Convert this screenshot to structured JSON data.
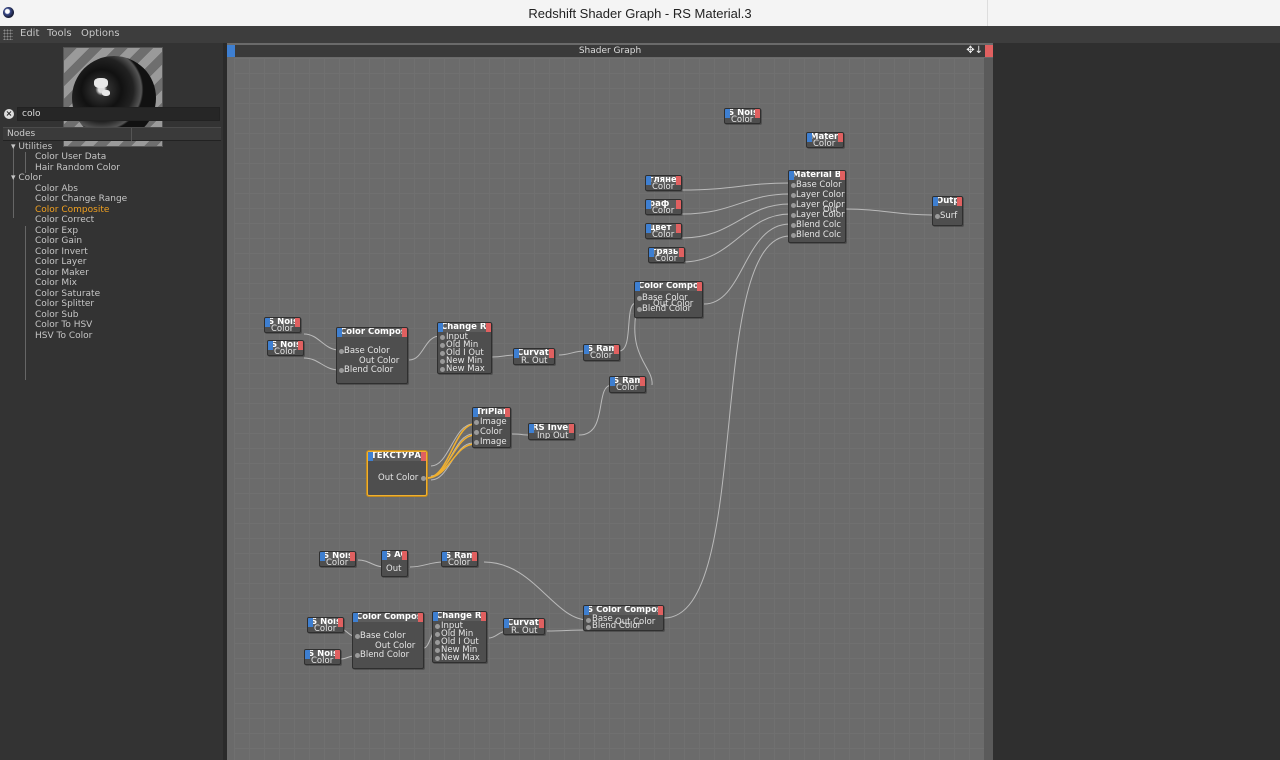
{
  "window": {
    "title": "Redshift Shader Graph - RS Material.3"
  },
  "menu": [
    "Edit",
    "Tools",
    "Options"
  ],
  "search": {
    "value": "colo"
  },
  "nodes_panel": {
    "header": "Nodes"
  },
  "tree": {
    "groups": [
      {
        "label": "Utilities",
        "items": [
          "Color User Data",
          "Hair Random Color"
        ]
      },
      {
        "label": "Color",
        "items": [
          "Color Abs",
          "Color Change Range",
          "Color Composite",
          "Color Correct",
          "Color Exp",
          "Color Gain",
          "Color Invert",
          "Color Layer",
          "Color Maker",
          "Color Mix",
          "Color Saturate",
          "Color Splitter",
          "Color Sub",
          "Color To HSV",
          "HSV To Color"
        ]
      }
    ],
    "highlighted": "Color Composite"
  },
  "graph": {
    "title": "Shader Graph",
    "toolbar_icons": [
      "move-icon",
      "arrow-down-icon"
    ],
    "nodes": [
      {
        "id": "noise_top",
        "title": "S Nois",
        "ports": [
          "Color"
        ]
      },
      {
        "id": "mater",
        "title": "Mater",
        "ports": [
          "Color"
        ]
      },
      {
        "id": "glyanec",
        "title": "глянец",
        "ports": [
          "Color"
        ]
      },
      {
        "id": "raf",
        "title": "раф",
        "ports": [
          "Color"
        ]
      },
      {
        "id": "cvet",
        "title": "цвет",
        "ports": [
          "Color"
        ]
      },
      {
        "id": "gryaz",
        "title": "грязь",
        "ports": [
          "Color"
        ]
      },
      {
        "id": "matblend",
        "title": "Material Blen",
        "ports": [
          "Base Color",
          "Layer Color",
          "Layer Color",
          "Layer Color",
          "Blend Colc",
          "Blend Colc"
        ],
        "out": "Out"
      },
      {
        "id": "output",
        "title": "Outpu",
        "ports": [
          "Surf"
        ]
      },
      {
        "id": "comp_top",
        "title": "Color Compo",
        "ports": [
          "Base Color",
          "Blend Color"
        ],
        "out": "Out Color"
      },
      {
        "id": "noise_a",
        "title": "S Nois",
        "ports": [
          "Color"
        ]
      },
      {
        "id": "noise_b",
        "title": "S Nois",
        "ports": [
          "Color"
        ]
      },
      {
        "id": "comp_mid",
        "title": "Color Compos",
        "ports": [
          "Base Color",
          "Blend Color"
        ],
        "out": "Out Color"
      },
      {
        "id": "range_mid",
        "title": "Change Ra",
        "ports": [
          "Input",
          "Old Min",
          "Old Max",
          "New Min",
          "New Max"
        ],
        "out": "Old I Out"
      },
      {
        "id": "curv_mid",
        "title": "Curvat",
        "ports": [
          "R. Out"
        ]
      },
      {
        "id": "ramp_mid",
        "title": "S Ram",
        "ports": [
          "Color"
        ]
      },
      {
        "id": "ramp_mid2",
        "title": "S Ram",
        "ports": [
          "Color"
        ]
      },
      {
        "id": "triplanar",
        "title": "TriPlar",
        "ports": [
          "Image",
          "Color",
          "Image"
        ]
      },
      {
        "id": "invert",
        "title": "RS Invert",
        "ports": [
          "Inp Out"
        ]
      },
      {
        "id": "texture",
        "title": "ТЕКСТУРА",
        "ports": [],
        "out": "Out Color"
      },
      {
        "id": "noise_c",
        "title": "S Nois",
        "ports": [
          "Color"
        ]
      },
      {
        "id": "ao",
        "title": "S AO",
        "ports": [
          "Out"
        ]
      },
      {
        "id": "ramp_low",
        "title": "S Ram",
        "ports": [
          "Color"
        ]
      },
      {
        "id": "noise_d",
        "title": "S Nois",
        "ports": [
          "Color"
        ]
      },
      {
        "id": "noise_e",
        "title": "S Nois",
        "ports": [
          "Color"
        ]
      },
      {
        "id": "comp_low",
        "title": "Color Compos",
        "ports": [
          "Base Color",
          "Blend Color"
        ],
        "out": "Out Color"
      },
      {
        "id": "range_low",
        "title": "Change Ra",
        "ports": [
          "Input",
          "Old Min",
          "Old Max",
          "New Min",
          "New Max"
        ],
        "out": "Old I Out"
      },
      {
        "id": "curv_low",
        "title": "Curvat",
        "ports": [
          "R. Out"
        ]
      },
      {
        "id": "comp_low2",
        "title": "S Color Composi",
        "ports": [
          "Base",
          "Blend Color"
        ],
        "out": "Out Color"
      }
    ]
  },
  "colors": {
    "accent_highlight": "#f0a020",
    "pin_in": "#3e7fd1",
    "pin_out": "#e06060",
    "selected_border": "#f0b030"
  }
}
